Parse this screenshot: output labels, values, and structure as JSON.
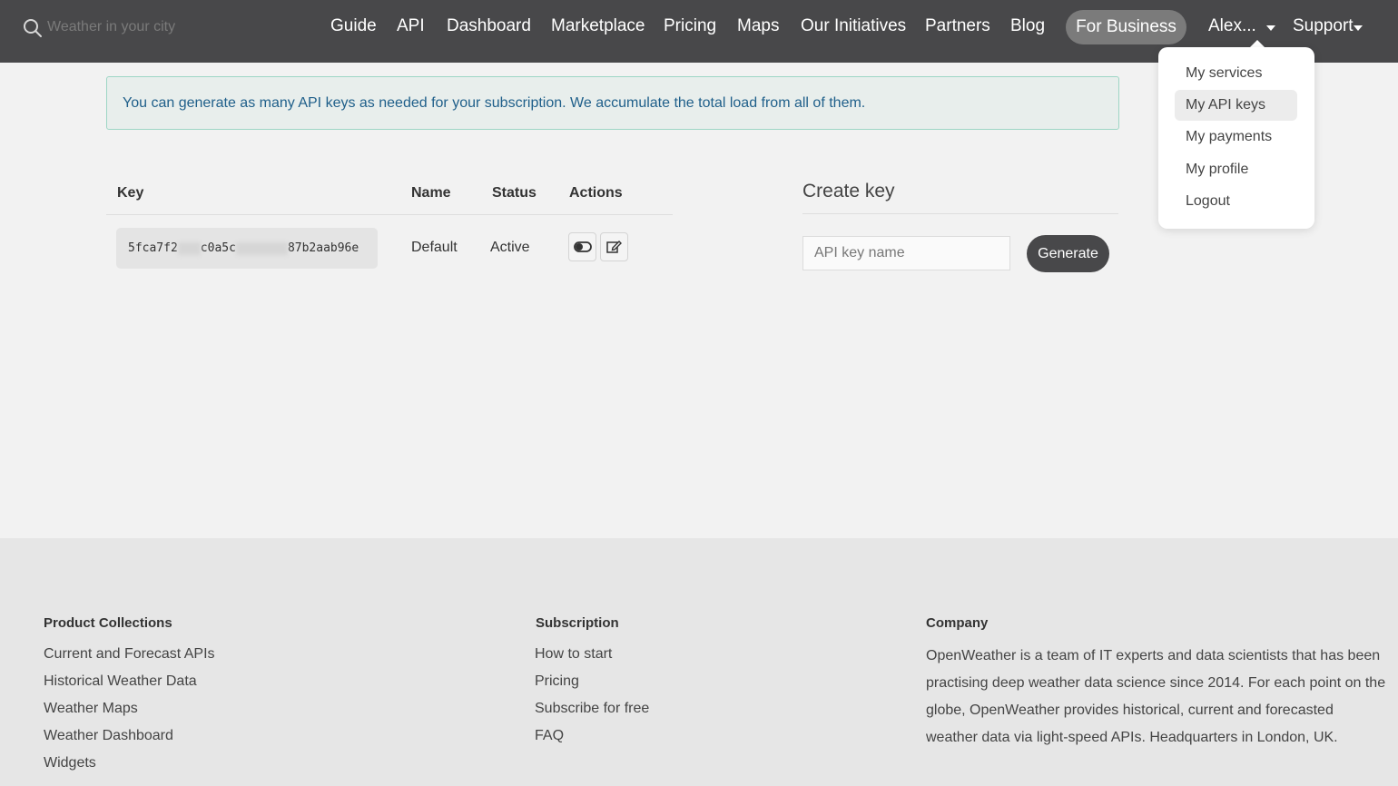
{
  "header": {
    "search_placeholder": "Weather in your city",
    "nav": [
      "Guide",
      "API",
      "Dashboard",
      "Marketplace",
      "Pricing",
      "Maps",
      "Our Initiatives",
      "Partners",
      "Blog"
    ],
    "business_label": "For Business",
    "user_label": "Alex...",
    "support_label": "Support"
  },
  "user_menu": {
    "items": [
      "My services",
      "My API keys",
      "My payments",
      "My profile",
      "Logout"
    ],
    "active": "My API keys"
  },
  "notice": {
    "text": "You can generate as many API keys as needed for your subscription. We accumulate the total load from all of them."
  },
  "keys_table": {
    "headers": [
      "Key",
      "Name",
      "Status",
      "Actions"
    ],
    "rows": [
      {
        "key_parts": [
          "5fca7f2",
          "c0a5c",
          "87b2aab96e"
        ],
        "name": "Default",
        "status": "Active"
      }
    ]
  },
  "create_key": {
    "title": "Create key",
    "input_placeholder": "API key name",
    "button_label": "Generate"
  },
  "footer": {
    "product": {
      "heading": "Product Collections",
      "links": [
        "Current and Forecast APIs",
        "Historical Weather Data",
        "Weather Maps",
        "Weather Dashboard",
        "Widgets"
      ]
    },
    "subscription": {
      "heading": "Subscription",
      "links": [
        "How to start",
        "Pricing",
        "Subscribe for free",
        "FAQ"
      ]
    },
    "company": {
      "heading": "Company",
      "text": "OpenWeather is a team of IT experts and data scientists that has been practising deep weather data science since 2014. For each point on the globe, OpenWeather provides historical, current and forecasted weather data via light-speed APIs. Headquarters in London, UK."
    }
  },
  "colors": {
    "header_bg": "#48484a",
    "notice_border": "#9ed6c5",
    "notice_text": "#1f5f8a",
    "footer_bg": "#e6e6e6"
  },
  "icons": [
    "search-icon",
    "toggle-icon",
    "edit-icon",
    "caret-down-icon"
  ]
}
